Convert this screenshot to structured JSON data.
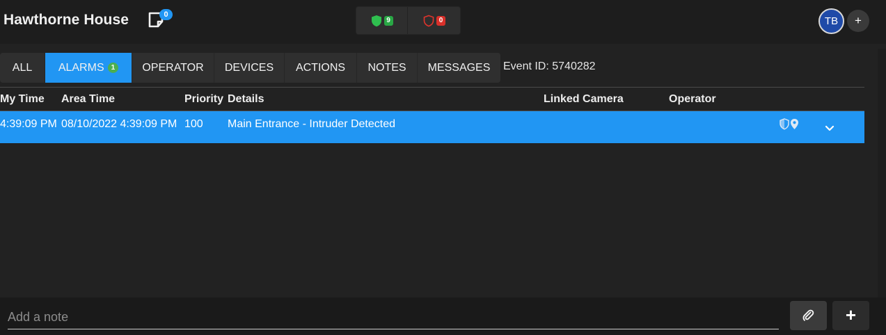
{
  "header": {
    "site_title": "Hawthorne House",
    "notes_count": "0",
    "secure_count": "9",
    "alarm_count": "0",
    "user_initials": "TB",
    "add_label": "+"
  },
  "tabs": [
    {
      "label": "ALL",
      "active": false
    },
    {
      "label": "ALARMS",
      "active": true,
      "badge": "1"
    },
    {
      "label": "OPERATOR",
      "active": false
    },
    {
      "label": "DEVICES",
      "active": false
    },
    {
      "label": "ACTIONS",
      "active": false
    },
    {
      "label": "NOTES",
      "active": false
    },
    {
      "label": "MESSAGES",
      "active": false
    }
  ],
  "event_id": "Event ID: 5740282",
  "table": {
    "columns": [
      "My Time",
      "Area Time",
      "Priority",
      "Details",
      "Linked Camera",
      "Operator"
    ],
    "rows": [
      {
        "my_time": "4:39:09 PM",
        "area_time": "08/10/2022 4:39:09 PM",
        "priority": "100",
        "details": "Main Entrance - Intruder Detected",
        "linked_camera": "",
        "operator": ""
      }
    ]
  },
  "note_bar": {
    "placeholder": "Add a note",
    "add_label": "+"
  },
  "colors": {
    "accent": "#2196f3",
    "secure": "#29a745",
    "alarm": "#d9302a"
  },
  "icons": {
    "notes": "note-icon",
    "secure": "shield-check-icon",
    "alarm": "shield-alert-icon",
    "row_shield": "shield-outline-icon",
    "row_location": "map-pin-icon",
    "expand": "chevron-down-icon",
    "attach": "paperclip-icon"
  }
}
